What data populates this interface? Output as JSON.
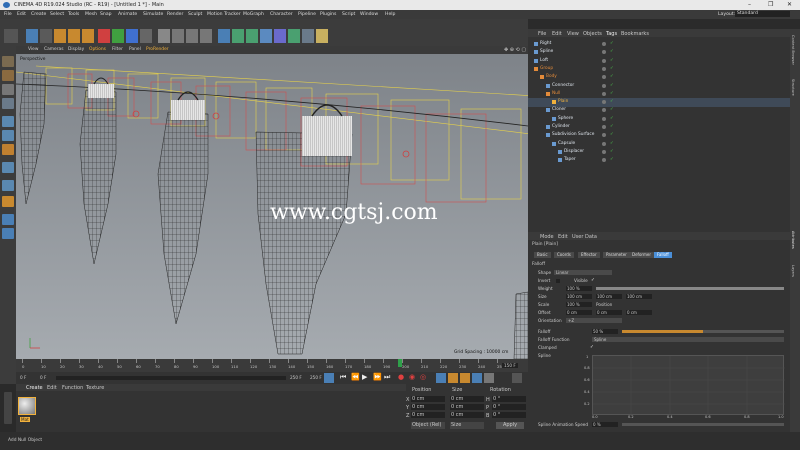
{
  "window": {
    "title": "CINEMA 4D R19.024 Studio (RC - R19) - [Untitled 1 *] - Main"
  },
  "menu": [
    "File",
    "Edit",
    "Create",
    "Select",
    "Tools",
    "Mesh",
    "Snap",
    "Animate",
    "Simulate",
    "Render",
    "Sculpt",
    "Motion Tracker",
    "MoGraph",
    "Character",
    "Pipeline",
    "Plugins",
    "Script",
    "Window",
    "Help"
  ],
  "layout": {
    "label": "Layout:",
    "value": "Standard"
  },
  "viewport": {
    "menu": [
      "View",
      "Cameras",
      "Display",
      "Options",
      "Filter",
      "Panel",
      "ProRender"
    ],
    "label": "Perspective",
    "grid_spacing": "Grid Spacing : 10000 cm",
    "watermark": "www.cgtsj.com"
  },
  "timeline": {
    "ticks": [
      "0",
      "10",
      "20",
      "30",
      "40",
      "50",
      "60",
      "70",
      "80",
      "90",
      "100",
      "110",
      "120",
      "130",
      "140",
      "150",
      "160",
      "170",
      "180",
      "190",
      "200",
      "210",
      "220",
      "230",
      "240",
      "250"
    ],
    "current_frame": "150 F",
    "start": "0 F",
    "field_a": "0 F",
    "end_a": "250 F",
    "end_b": "250 F"
  },
  "material": {
    "menu": [
      "Create",
      "Edit",
      "Function",
      "Texture"
    ],
    "item_label": "Mat"
  },
  "coords": {
    "headers": [
      "Position",
      "Size",
      "Rotation"
    ],
    "rows": [
      {
        "axis": "X",
        "pos": "0 cm",
        "size": "0 cm",
        "rot_axis": "H",
        "rot": "0 °"
      },
      {
        "axis": "Y",
        "pos": "0 cm",
        "size": "0 cm",
        "rot_axis": "P",
        "rot": "0 °"
      },
      {
        "axis": "Z",
        "pos": "0 cm",
        "size": "0 cm",
        "rot_axis": "B",
        "rot": "0 °"
      }
    ],
    "mode": "Object (Rel)",
    "size_mode": "Size",
    "apply": "Apply"
  },
  "status": "Add Null Object",
  "objects": {
    "menu": [
      "File",
      "Edit",
      "View",
      "Objects",
      "Tags",
      "Bookmarks"
    ],
    "items": [
      {
        "name": "Right",
        "indent": 0,
        "color": "#dfe6ee"
      },
      {
        "name": "Spline",
        "indent": 0,
        "color": "#dfe6ee"
      },
      {
        "name": "Loft",
        "indent": 0,
        "color": "#dfe6ee"
      },
      {
        "name": "Group",
        "indent": 0,
        "color": "#e38b3a"
      },
      {
        "name": "Body",
        "indent": 1,
        "color": "#e38b3a"
      },
      {
        "name": "Connector",
        "indent": 2,
        "color": "#dfe6ee"
      },
      {
        "name": "Null",
        "indent": 2,
        "color": "#e38b3a"
      },
      {
        "name": "Plain",
        "indent": 3,
        "color": "#f2b23c"
      },
      {
        "name": "Cloner",
        "indent": 2,
        "color": "#dfe6ee"
      },
      {
        "name": "Sphere",
        "indent": 3,
        "color": "#dfe6ee"
      },
      {
        "name": "Cylinder",
        "indent": 2,
        "color": "#dfe6ee"
      },
      {
        "name": "Subdivision Surface",
        "indent": 2,
        "color": "#dfe6ee"
      },
      {
        "name": "Capsule",
        "indent": 3,
        "color": "#dfe6ee"
      },
      {
        "name": "Displacer",
        "indent": 4,
        "color": "#dfe6ee"
      },
      {
        "name": "Taper",
        "indent": 4,
        "color": "#dfe6ee"
      }
    ]
  },
  "attributes": {
    "menu": [
      "Mode",
      "Edit",
      "User Data"
    ],
    "title": "Plain [Plain]",
    "tabs": [
      "Basic",
      "Coords",
      "Effector",
      "Parameter",
      "Deformer",
      "Falloff"
    ],
    "section": "Falloff",
    "shape_label": "Shape",
    "shape_value": "Linear",
    "invert_label": "Invert",
    "visible_label": "Visible",
    "weight_label": "Weight",
    "weight_value": "100 %",
    "size_label": "Size",
    "size_values": [
      "100 cm",
      "100 cm",
      "100 cm"
    ],
    "scale_label": "Scale",
    "scale_value": "100 %",
    "position_label": "Position",
    "offset_label": "Offset",
    "offset_values": [
      "0 cm",
      "0 cm",
      "0 cm"
    ],
    "orientation_label": "Orientation",
    "orientation_value": "+Z",
    "falloff_label": "Falloff",
    "falloff_value": "50 %",
    "falloff_fraction": 0.5,
    "falloff_function_label": "Falloff Function",
    "falloff_function_value": "Spline",
    "clamped_label": "Clamped",
    "spline_label": "Spline",
    "graph_y": [
      "1",
      "0.8",
      "0.6",
      "0.4",
      "0.2"
    ],
    "graph_x": [
      "0.0",
      "0.2",
      "0.4",
      "0.6",
      "0.8",
      "1.0"
    ],
    "spline_speed_label": "Spline Animation Speed",
    "spline_speed_value": "0 %"
  },
  "side_tabs": [
    "Content Browser",
    "Structure",
    "Attributes",
    "Layers"
  ],
  "colors": {
    "accent": "#4a8fd8",
    "orange": "#e38b3a",
    "highlight": "#f2b23c"
  }
}
